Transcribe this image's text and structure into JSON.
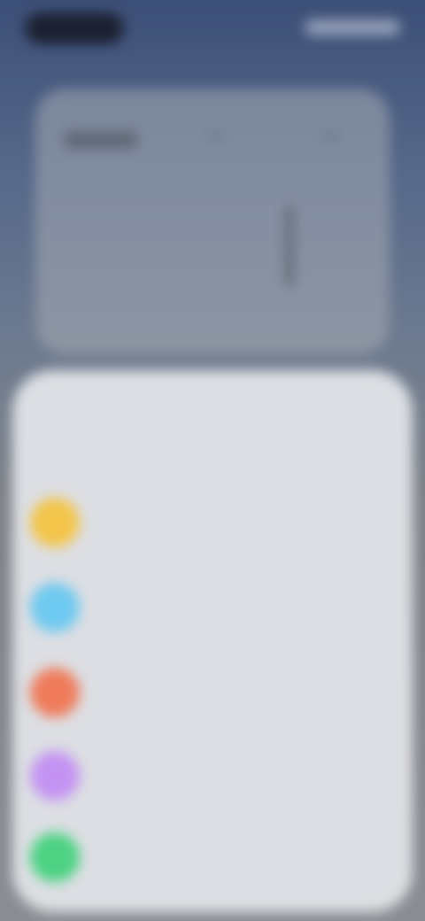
{
  "sheet": {
    "title": "",
    "options": [
      {
        "icon": "yellow-circle-icon",
        "color": "#f3c54a",
        "title": "",
        "subtitle": ""
      },
      {
        "icon": "blue-circle-icon",
        "color": "#6ec9f0",
        "title": "",
        "subtitle": ""
      },
      {
        "icon": "orange-circle-icon",
        "color": "#ef7b5a",
        "title": "",
        "subtitle": ""
      },
      {
        "icon": "purple-circle-icon",
        "color": "#c493f2",
        "title": "",
        "subtitle": ""
      },
      {
        "icon": "green-circle-icon",
        "color": "#4cd282",
        "title": "",
        "subtitle": ""
      }
    ]
  },
  "colors": {
    "sheet_background": "#dcdee3",
    "status_pill": "#1c2233"
  }
}
